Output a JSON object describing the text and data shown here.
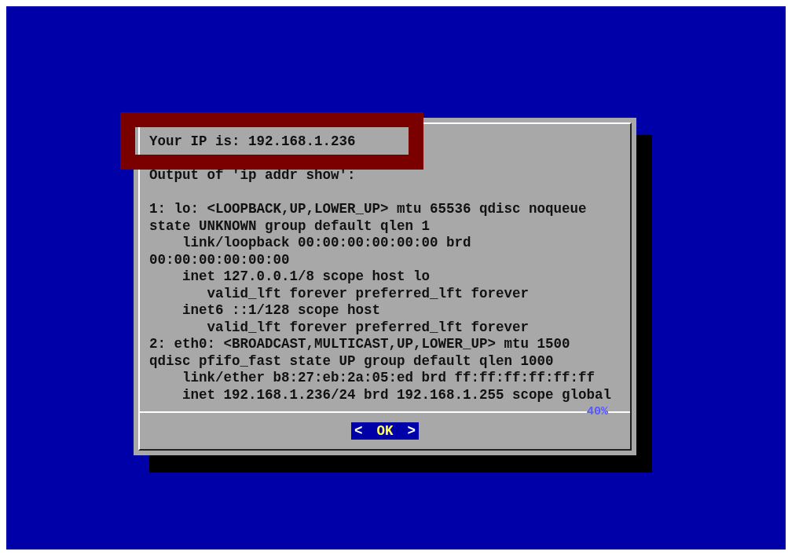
{
  "dialog": {
    "paragraphs": [
      [
        "Your IP is: 192.168.1.236"
      ],
      [
        "Output of 'ip addr show':"
      ],
      [
        "1: lo: <LOOPBACK,UP,LOWER_UP> mtu 65536 qdisc noqueue",
        "state UNKNOWN group default qlen 1",
        "    link/loopback 00:00:00:00:00:00 brd",
        "00:00:00:00:00:00",
        "    inet 127.0.0.1/8 scope host lo",
        "       valid_lft forever preferred_lft forever",
        "    inet6 ::1/128 scope host",
        "       valid_lft forever preferred_lft forever",
        "2: eth0: <BROADCAST,MULTICAST,UP,LOWER_UP> mtu 1500",
        "qdisc pfifo_fast state UP group default qlen 1000",
        "    link/ether b8:27:eb:2a:05:ed brd ff:ff:ff:ff:ff:ff",
        "    inet 192.168.1.236/24 brd 192.168.1.255 scope global"
      ]
    ],
    "scroll_percent": "40%",
    "buttons": [
      {
        "open": "<",
        "label": "OK",
        "close": ">",
        "selected": true
      }
    ]
  }
}
